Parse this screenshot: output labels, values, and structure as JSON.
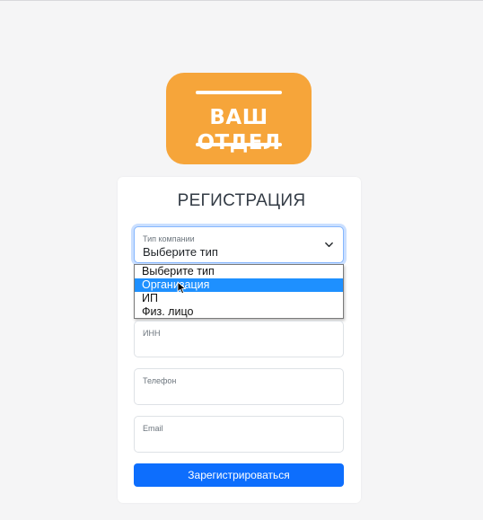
{
  "logo": {
    "text": "ВАШ ОТДЕЛ"
  },
  "form": {
    "title": "РЕГИСТРАЦИЯ",
    "company_type": {
      "label": "Тип компании",
      "value": "Выберите тип",
      "options": [
        "Выберите тип",
        "Организация",
        "ИП",
        "Физ. лицо"
      ],
      "highlighted": "Организация"
    },
    "inn": {
      "label": "ИНН",
      "value": ""
    },
    "phone": {
      "label": "Телефон",
      "value": ""
    },
    "email": {
      "label": "Email",
      "value": ""
    },
    "submit_label": "Зарегистрироваться"
  },
  "colors": {
    "logo_bg": "#f6a53a",
    "primary": "#0d6efd",
    "highlight": "#1e90ff"
  }
}
